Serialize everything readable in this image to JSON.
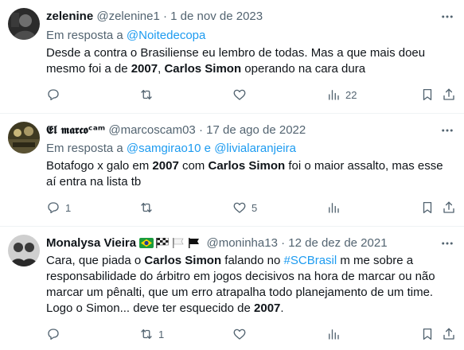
{
  "tweets": [
    {
      "name": "zelenine",
      "handle": "@zelenine1",
      "sep": "·",
      "date": "1 de nov de 2023",
      "reply_prefix": "Em resposta a ",
      "reply_to": "@Noitedecopa",
      "text_parts": [
        "Desde a contra o Brasiliense eu lembro de todas. Mas a que mais doeu mesmo foi a de ",
        "2007",
        ", ",
        "Carlos Simon",
        " operando na cara dura"
      ],
      "stats": {
        "replies": "",
        "retweets": "",
        "likes": "",
        "views": "22"
      }
    },
    {
      "name": "𝕰𝖑 𝖒𝖆𝖗𝖈𝖔ᶜᵃᵐ",
      "handle": "@marcoscam03",
      "sep": "·",
      "date": "17 de ago de 2022",
      "reply_prefix": "Em resposta a ",
      "reply_to": "@samgirao10",
      "reply_and": " e ",
      "reply_to_2": "@livialaranjeira",
      "text_parts": [
        "Botafogo x galo em ",
        "2007",
        " com ",
        "Carlos Simon",
        " foi o maior assalto, mas esse aí entra na lista tb"
      ],
      "stats": {
        "replies": "1",
        "retweets": "",
        "likes": "5",
        "views": ""
      }
    },
    {
      "name": "Monalysa Vieira",
      "handle": "@moninha13",
      "sep": "·",
      "date": "12 de dez de 2021",
      "text_parts": [
        "Cara, que piada o ",
        "Carlos Simon",
        " falando no ",
        "#SCBrasil",
        " m me sobre a responsabilidade do árbitro em jogos decisivos na hora de marcar ou não marcar um pênalti, que um erro atrapalha todo planejamento de um time. Logo o Simon... deve ter esquecido de ",
        "2007",
        "."
      ],
      "stats": {
        "replies": "",
        "retweets": "1",
        "likes": "",
        "views": ""
      }
    }
  ],
  "icons": {
    "more": "more-dots-icon",
    "reply": "comment-icon",
    "retweet": "retweet-icon",
    "like": "heart-icon",
    "views": "views-chart-icon",
    "bookmark": "bookmark-icon",
    "share": "share-icon"
  },
  "colors": {
    "link": "#1d9bf0",
    "muted": "#536471",
    "text": "#0f1419"
  }
}
